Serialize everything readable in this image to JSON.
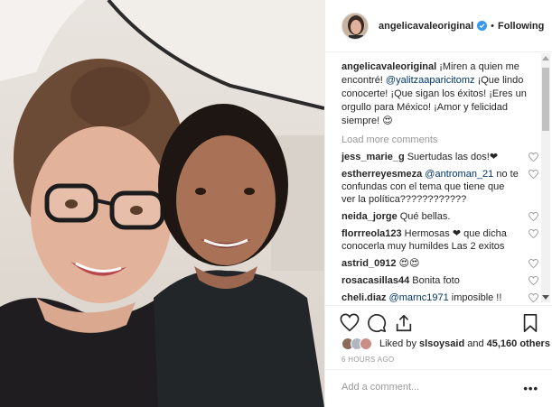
{
  "header": {
    "username": "angelicavaleoriginal",
    "separator": "•",
    "follow_status": "Following"
  },
  "caption": {
    "username": "angelicavaleoriginal",
    "text_before": " ¡Miren a quien me encontré! ",
    "mention": "@yalitzaaparicitomz",
    "text_after": " ¡Que lindo conocerte! ¡Que sigan los éxitos! ¡Eres un orgullo para México! ¡Amor y felicidad siempre! 😍"
  },
  "load_more": "Load more comments",
  "comments": [
    {
      "user": "jess_marie_g",
      "text": "Suertudas las dos!❤"
    },
    {
      "user": "estherreyesmeza",
      "mention": "@antroman_21",
      "text": " no te confundas con el tema que tiene que ver la política????????????"
    },
    {
      "user": "neida_jorge",
      "text": "Qué bellas."
    },
    {
      "user": "florrreola123",
      "text": "Hermosas ❤ que dicha conocerla muy humildes Las 2 exitos"
    },
    {
      "user": "astrid_0912",
      "text": "😍😍"
    },
    {
      "user": "rosacasillas44",
      "text": "Bonita foto"
    },
    {
      "user": "cheli.diaz",
      "mention": "@marnc1971",
      "text": " imposible !! Que se an iguales una esta mas india que la otra"
    }
  ],
  "likes": {
    "prefix": "Liked by ",
    "user": "slsoysaid",
    "middle": " and ",
    "count": "45,160 others"
  },
  "time": "6 HOURS AGO",
  "add_comment_placeholder": "Add a comment...",
  "more_label": "•••",
  "colors": {
    "verified": "#3897f0",
    "link": "#003569",
    "muted": "#999999",
    "heart": "#ed4956"
  }
}
